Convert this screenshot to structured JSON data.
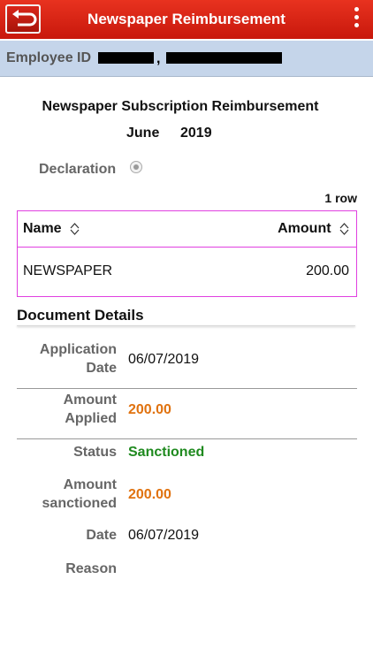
{
  "app": {
    "title": "Newspaper Reimbursement",
    "back_icon": "back-arrow-icon",
    "menu_icon": "more-vertical-icon",
    "accent_color": "#d9261a"
  },
  "employee": {
    "label": "Employee ID",
    "separator": ","
  },
  "form": {
    "heading": "Newspaper Subscription Reimbursement",
    "month": "June",
    "year": "2019",
    "declaration_label": "Declaration"
  },
  "table": {
    "row_count": "1 row",
    "columns": [
      "Name",
      "Amount"
    ],
    "rows": [
      {
        "name": "NEWSPAPER",
        "amount": "200.00"
      }
    ]
  },
  "details": {
    "section_title": "Document Details",
    "application_date_label_1": "Application",
    "application_date_label_2": "Date",
    "application_date": "06/07/2019",
    "amount_applied_label_1": "Amount",
    "amount_applied_label_2": "Applied",
    "amount_applied": "200.00",
    "status_label": "Status",
    "status": "Sanctioned",
    "amount_sanctioned_label_1": "Amount",
    "amount_sanctioned_label_2": "sanctioned",
    "amount_sanctioned": "200.00",
    "date_label": "Date",
    "date": "06/07/2019",
    "reason_label": "Reason",
    "status_color": "#1f8a1f",
    "amount_color": "#e0720f"
  }
}
